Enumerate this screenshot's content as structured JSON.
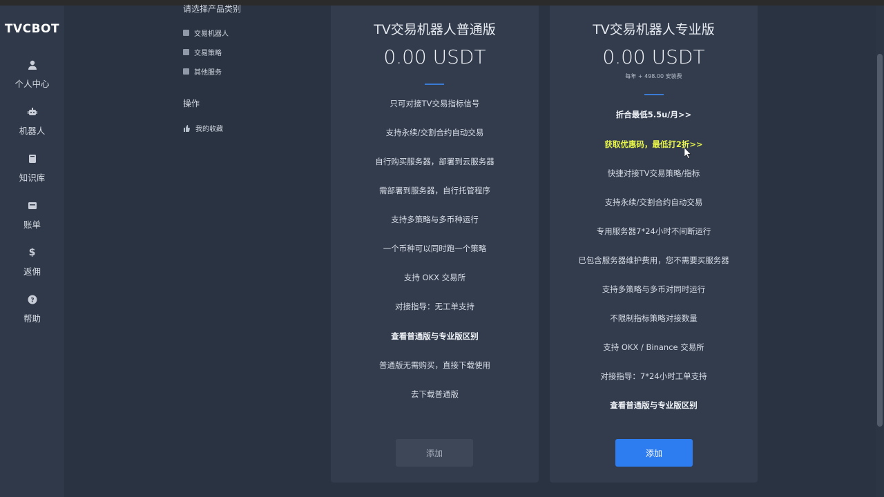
{
  "app": {
    "logo": "TVCBOT"
  },
  "sidebar": {
    "items": [
      {
        "label": "个人中心",
        "icon": "user-icon"
      },
      {
        "label": "机器人",
        "icon": "robot-icon"
      },
      {
        "label": "知识库",
        "icon": "book-icon"
      },
      {
        "label": "账单",
        "icon": "bill-icon"
      },
      {
        "label": "返佣",
        "icon": "dollar-icon"
      },
      {
        "label": "帮助",
        "icon": "help-icon"
      }
    ]
  },
  "filters": {
    "header": "请选择产品类别",
    "categories": [
      {
        "label": "交易机器人"
      },
      {
        "label": "交易策略"
      },
      {
        "label": "其他服务"
      }
    ],
    "ops_header": "操作",
    "favorites_label": "我的收藏"
  },
  "plans": {
    "basic": {
      "title": "TV交易机器人普通版",
      "price": "0.00 USDT",
      "features": [
        "只可对接TV交易指标信号",
        "支持永续/交割合约自动交易",
        "自行购买服务器，部署到云服务器",
        "需部署到服务器，自行托管程序",
        "支持多策略与多币种运行",
        "一个币种可以同时跑一个策略",
        "支持 OKX 交易所",
        "对接指导：无工单支持"
      ],
      "compare_link": "查看普通版与专业版区别",
      "free_note": "普通版无需购买，直接下载使用",
      "download_link": "去下载普通版",
      "add_button": "添加"
    },
    "pro": {
      "title": "TV交易机器人专业版",
      "price": "0.00 USDT",
      "install_note": "每年 + 498.00 安装费",
      "monthly_link": "折合最低5.5u/月>>",
      "coupon_link": "获取优惠码，最低打2折>>",
      "features": [
        "快捷对接TV交易策略/指标",
        "支持永续/交割合约自动交易",
        "专用服务器7*24小时不间断运行",
        "已包含服务器维护费用，您不需要买服务器",
        "支持多策略与多币对同时运行",
        "不限制指标策略对接数量",
        "支持 OKX / Binance 交易所",
        "对接指导：7*24小时工单支持"
      ],
      "compare_link": "查看普通版与专业版区别",
      "add_button": "添加"
    }
  },
  "colors": {
    "accent": "#2d7cf0",
    "highlight": "#e8f54a",
    "background": "#2a3342",
    "card": "#323c4d"
  }
}
